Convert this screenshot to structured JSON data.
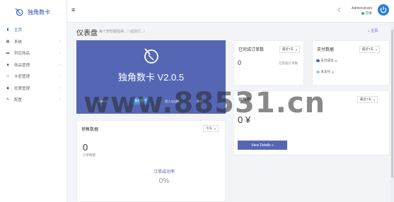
{
  "brand": {
    "name": "独角数卡"
  },
  "sidebar": {
    "items": [
      {
        "label": "主页",
        "icon": "bar-chart-icon",
        "active": true
      },
      {
        "label": "系统",
        "icon": "grid-icon"
      },
      {
        "label": "供应商品",
        "icon": "cart-icon"
      },
      {
        "label": "商品管理",
        "icon": "box-icon"
      },
      {
        "label": "卡密管理",
        "icon": "card-icon"
      },
      {
        "label": "优惠管理",
        "icon": "tag-icon"
      },
      {
        "label": "配置",
        "icon": "wrench-icon"
      }
    ]
  },
  "topbar": {
    "user_name": "Administrator",
    "user_status": "在线"
  },
  "page": {
    "title": "仪表盘",
    "subtitle": "每个梦想都值得...一起前行...!",
    "breadcrumb": "主页"
  },
  "hero": {
    "title": "独角数卡 V2.0.5",
    "links": [
      "GitHub",
      "独角数卡",
      "加入QQ群",
      "文档"
    ]
  },
  "cards": {
    "pending": {
      "title": "已完成订单数",
      "range": "最近7天",
      "value": "0",
      "label": "已完成订单数"
    },
    "payments": {
      "title": "支付数据",
      "range": "最近7天",
      "legend": [
        {
          "label": "支付成功",
          "value": "0",
          "color": "#5567b4"
        },
        {
          "label": "未支付",
          "value": "0",
          "color": "#9ac6f2"
        }
      ]
    },
    "revenue": {
      "title": "销售额",
      "range": "最近7天",
      "value": "0 ¥",
      "button": "View Details"
    },
    "sales": {
      "title": "销售数据",
      "range": "今天",
      "value": "0",
      "label": "订单数量",
      "rate_label": "订单成功率",
      "rate_value": "0%"
    }
  },
  "watermark": "www.88531.cn"
}
